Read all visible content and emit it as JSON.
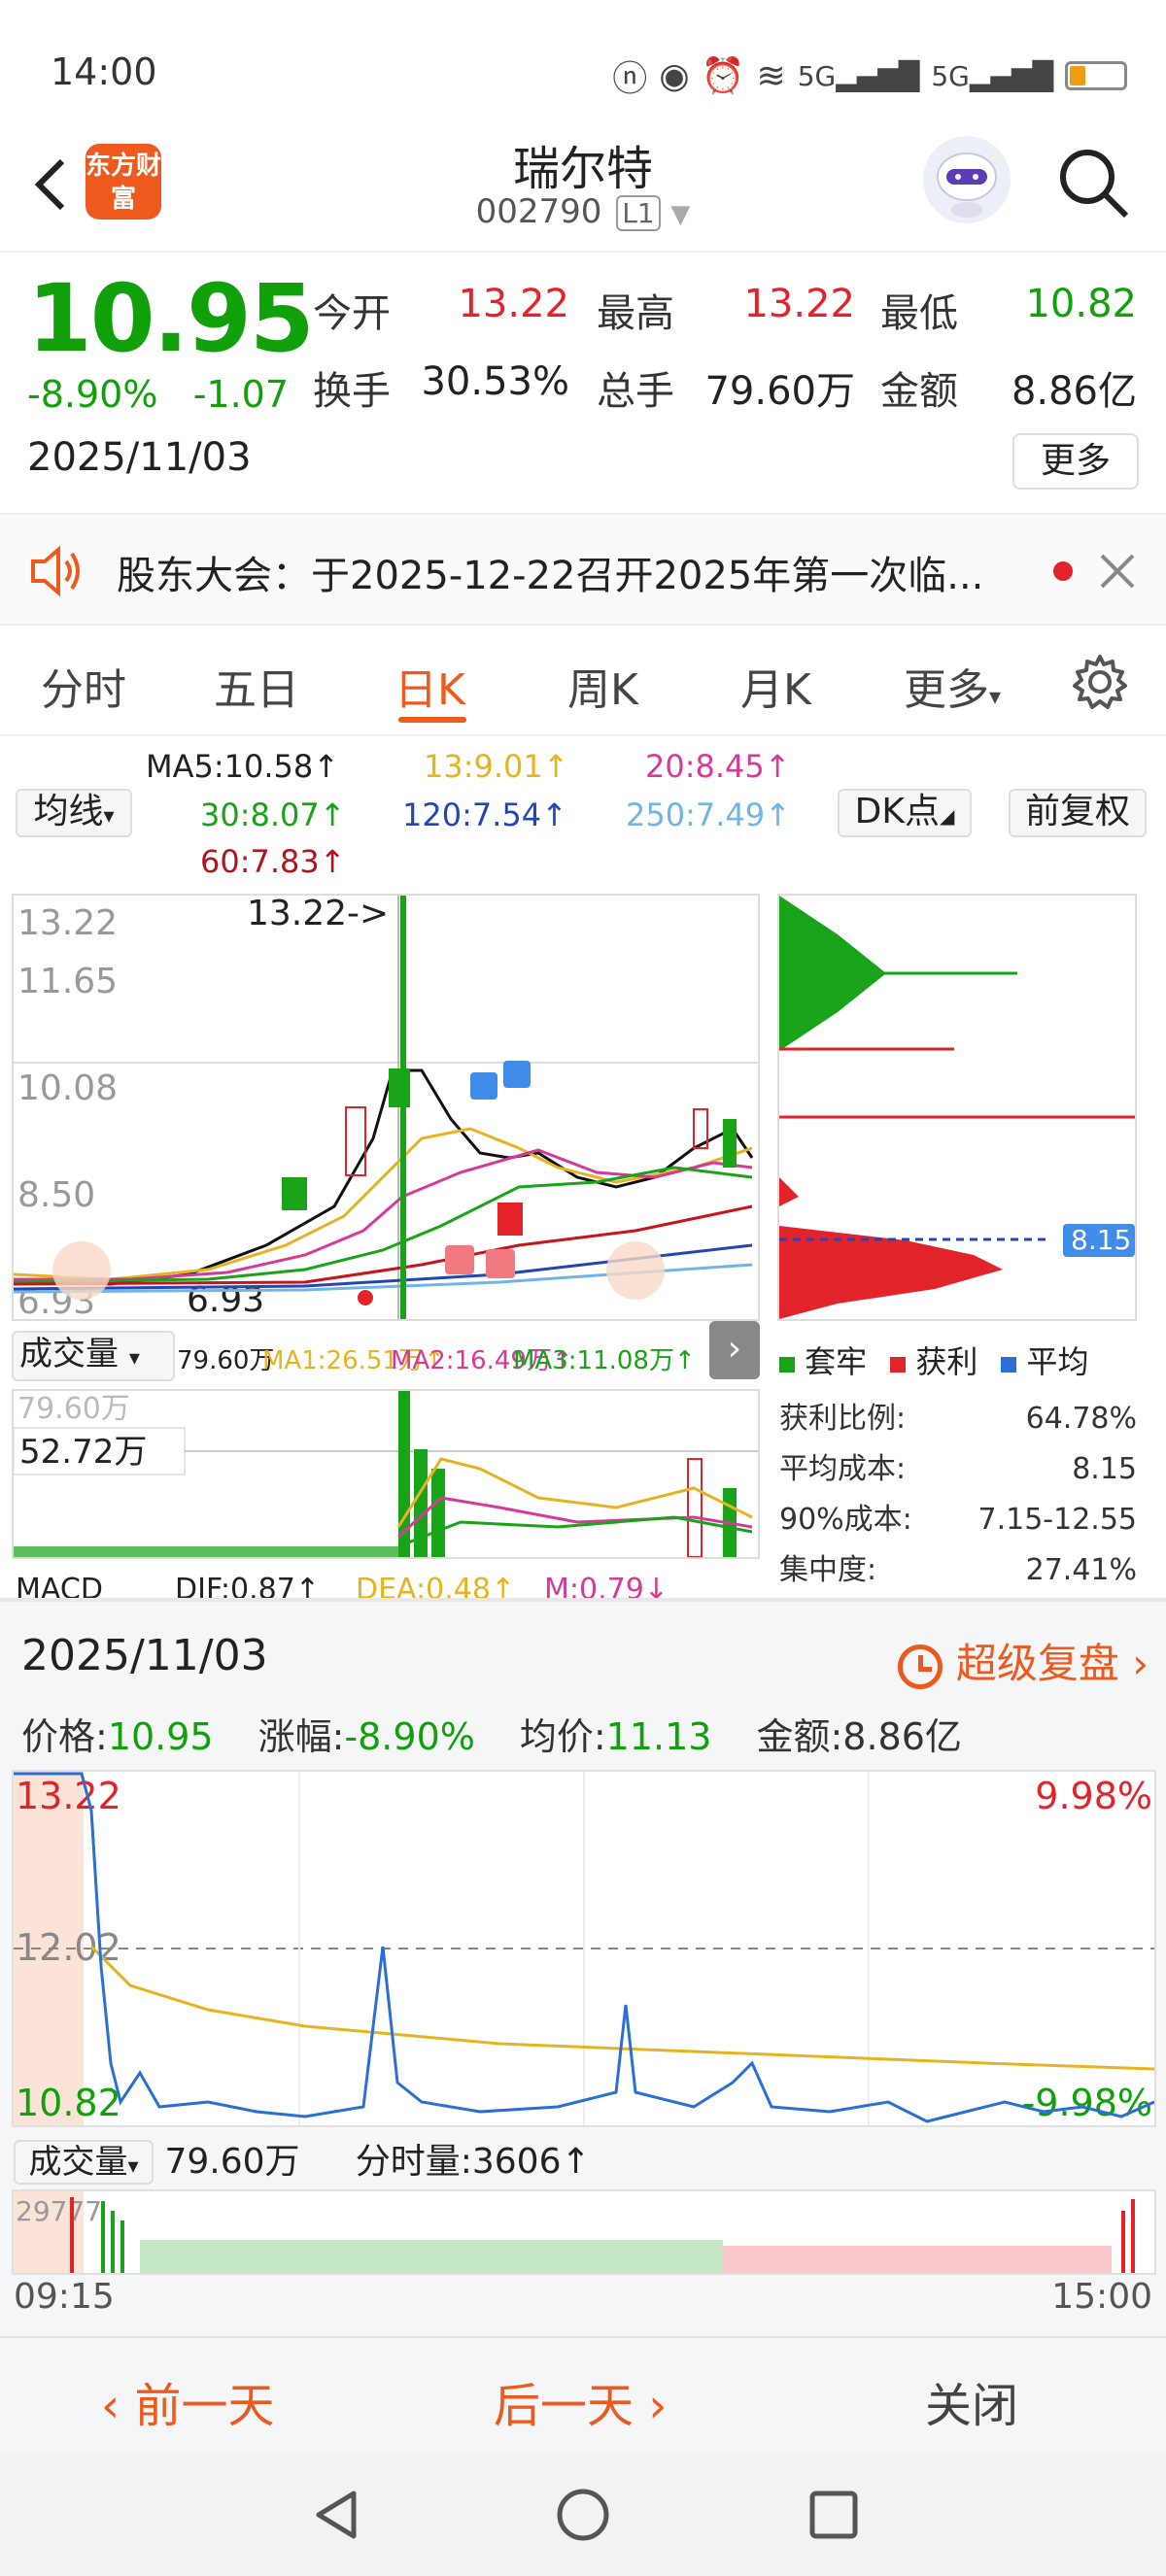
{
  "status": {
    "time": "14:00"
  },
  "header": {
    "logo_text": "东方财富",
    "title": "瑞尔特",
    "code": "002790",
    "level_badge": "L1"
  },
  "quote": {
    "price": "10.95",
    "change_pct": "-8.90%",
    "change_amt": "-1.07",
    "date": "2025/11/03",
    "open_label": "今开",
    "open": "13.22",
    "high_label": "最高",
    "high": "13.22",
    "low_label": "最低",
    "low": "10.82",
    "turnover_label": "换手",
    "turnover": "30.53%",
    "volume_label": "总手",
    "volume": "79.60万",
    "amount_label": "金额",
    "amount": "8.86亿",
    "more_label": "更多"
  },
  "notice": {
    "text": "股东大会：于2025-12-22召开2025年第一次临..."
  },
  "tabs": [
    "分时",
    "五日",
    "日K",
    "周K",
    "月K",
    "更多"
  ],
  "ma": {
    "selector": "均线",
    "ma5": "MA5:10.58↑",
    "ma13": "13:9.01↑",
    "ma20": "20:8.45↑",
    "ma30": "30:8.07↑",
    "ma120": "120:7.54↑",
    "ma250": "250:7.49↑",
    "ma60": "60:7.83↑",
    "dk": "DK点",
    "adjust": "前复权"
  },
  "kchart": {
    "y_top": "13.22",
    "y2": "11.65",
    "y3": "10.08",
    "y4": "8.50",
    "y_bot": "6.93",
    "high_marker": "13.22->",
    "low_marker": "6.93",
    "chip_avg": "8.15"
  },
  "volume": {
    "selector": "成交量",
    "value": "79.60万",
    "ma1": "MA1:26.51万↑",
    "ma2": "MA2:16.49万↑",
    "ma3": "MA3:11.08万↑",
    "top_label": "79.60万",
    "mid_label": "52.72万"
  },
  "chip": {
    "legend": [
      "套牢",
      "获利",
      "平均"
    ],
    "rows": [
      {
        "label": "获利比例:",
        "value": "64.78%"
      },
      {
        "label": "平均成本:",
        "value": "8.15"
      },
      {
        "label": "90%成本:",
        "value": "7.15-12.55"
      },
      {
        "label": "集中度:",
        "value": "27.41%"
      }
    ]
  },
  "macd": {
    "text": "MACD",
    "dif": "DIF:0.87↑",
    "dea": "DEA:0.48↑",
    "m": "M:0.79↓"
  },
  "panel": {
    "date": "2025/11/03",
    "replay": "超级复盘",
    "price_label": "价格:",
    "price": "10.95",
    "chg_label": "涨幅:",
    "chg": "-8.90%",
    "avg_label": "均价:",
    "avg": "11.13",
    "amt_label": "金额:",
    "amt": "8.86亿"
  },
  "tchart": {
    "y_top": "13.22",
    "y_mid": "12.02",
    "y_bot": "10.82",
    "pct_top": "9.98%",
    "pct_bot": "-9.98%"
  },
  "tvol": {
    "selector": "成交量",
    "value": "79.60万",
    "tick_vol": "分时量:3606↑",
    "max": "29777"
  },
  "ticks": {
    "start": "09:15",
    "end": "15:00"
  },
  "bottombar": {
    "prev": "前一天",
    "next": "后一天",
    "close": "关闭"
  }
}
